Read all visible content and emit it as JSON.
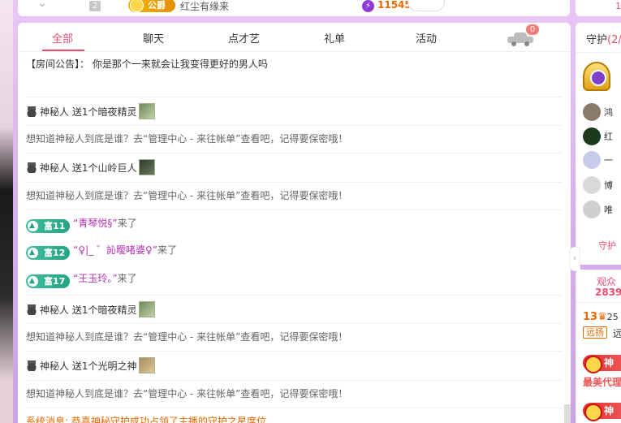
{
  "top_bar": {
    "rank_number": "2",
    "badge_label": "公爵",
    "username": "红尘有缘来",
    "score": "11545"
  },
  "tabs": [
    {
      "label": "全部",
      "active": true
    },
    {
      "label": "聊天",
      "active": false
    },
    {
      "label": "点才艺",
      "active": false
    },
    {
      "label": "礼单",
      "active": false
    },
    {
      "label": "活动",
      "active": false
    }
  ],
  "car_count": "0",
  "notice": "【房间公告】： 你是那个一来就会让我变得更好的男人吗",
  "messages": {
    "m1": "神秘人 送1个暗夜精灵",
    "m2": "想知道神秘人到底是谁？去“管理中心 - 来往帐单”查看吧，记得要保密哦！",
    "m3": "神秘人 送1个山岭巨人",
    "m4": "想知道神秘人到底是谁？去“管理中心 - 来往帐单”查看吧，记得要保密哦！",
    "m5_badge": "富11",
    "m5_name": "“青琴悦§”",
    "m5_tail": "来了",
    "m6_badge": "富12",
    "m6_name": "“♀|_ ゛訫曖啫婆♀”",
    "m6_tail": "来了",
    "m7_badge": "富17",
    "m7_name": "“王玉玲。”",
    "m7_tail": "来了",
    "m8": "神秘人 送1个暗夜精灵",
    "m9": "想知道神秘人到底是谁？去“管理中心 - 来往帐单”查看吧，记得要保密哦！",
    "m10": "神秘人 送1个光明之神",
    "m11": "想知道神秘人到底是谁？去“管理中心 - 来往帐单”查看吧，记得要保密哦！",
    "m12": "系统消息: 恭喜神秘守护成功占领了主播的守护之星席位"
  },
  "right": {
    "top_num": "1",
    "guard_title": "守护",
    "guard_count": "(2/",
    "guard_rows": [
      "鸿",
      "红",
      "一",
      "博",
      "唯"
    ],
    "guard_more": "守护",
    "audience_title": "观众",
    "audience_count": "2839",
    "level": "13",
    "level_tail": "25",
    "tag": "远扬",
    "tag_tail": "远",
    "god1": "神",
    "agent": "最美代理",
    "god2": "神"
  },
  "colors": {
    "accent": "#f04d73",
    "rich_badge": "#26a383",
    "welcome_name": "#b52fb3",
    "system_msg": "#e56a00"
  }
}
